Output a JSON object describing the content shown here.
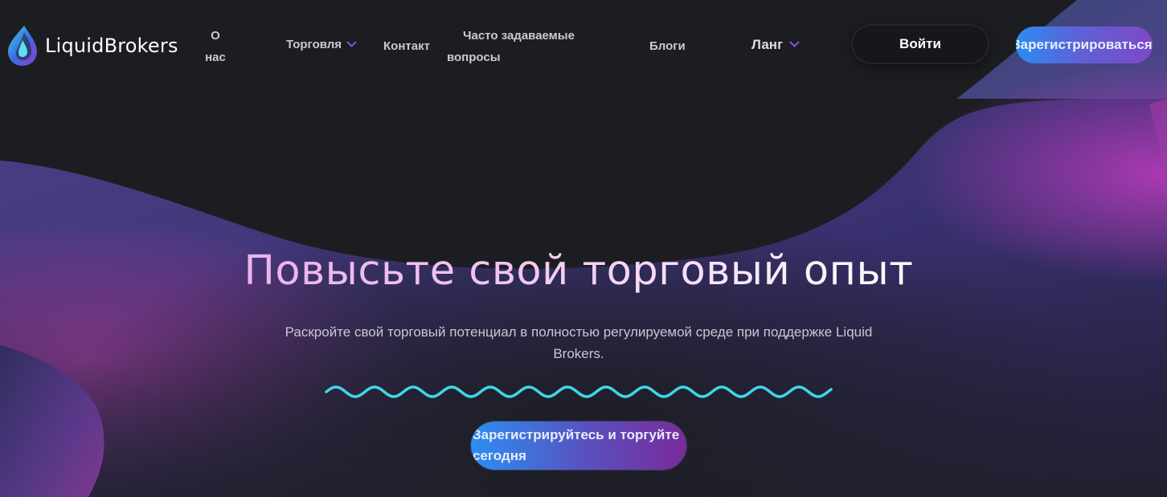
{
  "brand": {
    "name": "LiquidBrokers"
  },
  "nav": {
    "about": "О нас",
    "trading": "Торговля",
    "contact": "Контакт",
    "faq_line1": "Часто задаваемые",
    "faq_line2": "вопросы",
    "blogs": "Блоги",
    "lang": "Ланг"
  },
  "header_actions": {
    "login": "Войти",
    "register": "Зарегистрироваться"
  },
  "hero": {
    "title": "Повысьте свой торговый опыт",
    "subtitle": "Раскройте свой торговый потенциал в полностью регулируемой среде при поддержке Liquid Brokers.",
    "cta": "Зарегистрируйтесь и торгуйте сегодня"
  },
  "colors": {
    "background": "#1c1d20",
    "accent_blue": "#2a8cf2",
    "accent_purple": "#7d48c8",
    "wave": "#3fd6e6"
  },
  "icons": {
    "logo": "droplet-logo-icon",
    "dropdown": "chevron-down-icon"
  }
}
